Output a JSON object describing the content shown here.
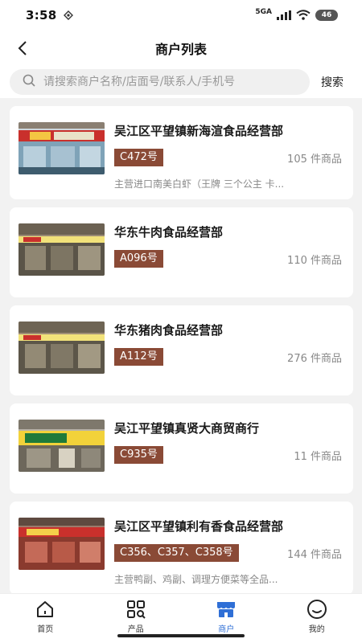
{
  "status_bar": {
    "time": "3:58",
    "network": "5GA",
    "battery": "46"
  },
  "nav": {
    "title": "商户列表"
  },
  "search": {
    "placeholder": "请搜索商户名称/店面号/联系人/手机号",
    "button_label": "搜索"
  },
  "merchants": [
    {
      "name": "吴江区平望镇新海渲食品经营部",
      "stall": "C472号",
      "count": "105 件商品",
      "description": "主营进口南美白虾（王牌 三个公主 卡..."
    },
    {
      "name": "华东牛肉食品经营部",
      "stall": "A096号",
      "count": "110 件商品",
      "description": ""
    },
    {
      "name": "华东猪肉食品经营部",
      "stall": "A112号",
      "count": "276 件商品",
      "description": ""
    },
    {
      "name": "吴江平望镇真贤大商贸商行",
      "stall": "C935号",
      "count": "11 件商品",
      "description": ""
    },
    {
      "name": "吴江区平望镇利有香食品经营部",
      "stall": "C356、C357、C358号",
      "count": "144 件商品",
      "description": "主营鸭副、鸡副、调理方便菜等全品..."
    }
  ],
  "tabs": [
    {
      "label": "首页",
      "icon": "home-icon",
      "active": false
    },
    {
      "label": "产品",
      "icon": "grid-search-icon",
      "active": false
    },
    {
      "label": "商户",
      "icon": "store-icon",
      "active": true
    },
    {
      "label": "我的",
      "icon": "smiley-icon",
      "active": false
    }
  ],
  "colors": {
    "accent": "#2f6fd6",
    "stall_badge": "#8a4a36"
  }
}
